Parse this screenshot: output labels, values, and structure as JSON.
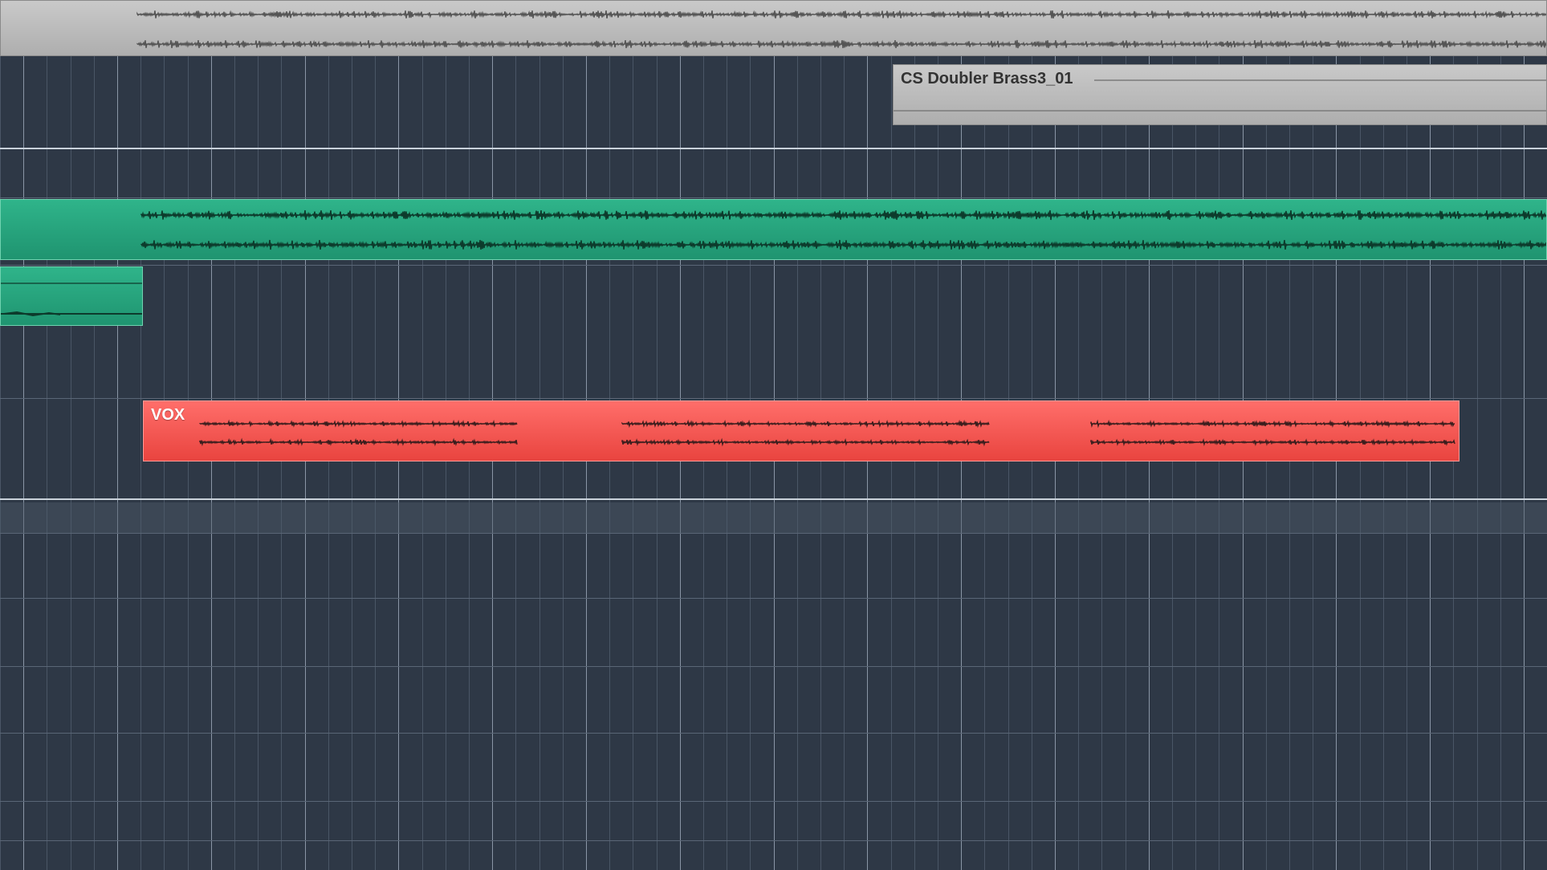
{
  "colors": {
    "background": "#2e3846",
    "gray_region": "#b9b9b9",
    "green_region": "#27a27c",
    "red_region": "#f2524e"
  },
  "regions": {
    "top_audio": {
      "name": "",
      "color": "gray"
    },
    "brass": {
      "name": "CS Doubler Brass3_01",
      "color": "gray"
    },
    "green_long": {
      "name": "",
      "color": "green"
    },
    "green_short": {
      "name": "",
      "color": "green"
    },
    "vox": {
      "name": "VOX",
      "color": "red"
    }
  }
}
